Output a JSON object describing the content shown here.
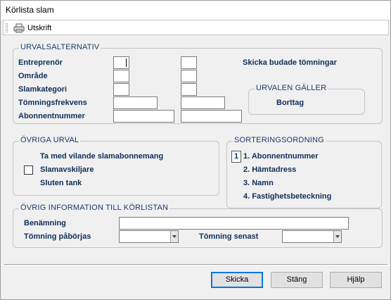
{
  "window": {
    "title": "Körlista slam"
  },
  "toolbar": {
    "print_label": "Utskrift"
  },
  "urval": {
    "legend": "URVALSALTERNATIV",
    "rows": [
      "Entreprenör",
      "Område",
      "Slamkategori",
      "Tömningsfrekvens",
      "Abonnentnummer"
    ],
    "send_bid_label": "Skicka budade tömningar",
    "valid_legend": "URVALEN GÄLLER",
    "valid_value": "Borttag"
  },
  "ovriga": {
    "legend": "ÖVRIGA URVAL",
    "include_inactive": "Ta med vilande slamabonnemang",
    "separator": "Slamavskiljare",
    "closed_tank": "Sluten tank"
  },
  "sort": {
    "legend": "SORTERINGSORDNING",
    "selected_index": "1",
    "items": [
      "1. Abonnentnummer",
      "2. Hämtadress",
      "3. Namn",
      "4. Fastighetsbeteckning"
    ]
  },
  "info": {
    "legend": "ÖVRIG INFORMATION TILL KÖRLISTAN",
    "name_label": "Benämning",
    "name_value": "",
    "start_label": "Tömning påbörjas",
    "start_value": "",
    "latest_label": "Tömning senast",
    "latest_value": ""
  },
  "buttons": {
    "send": "Skicka",
    "close": "Stäng",
    "help": "Hjälp"
  }
}
